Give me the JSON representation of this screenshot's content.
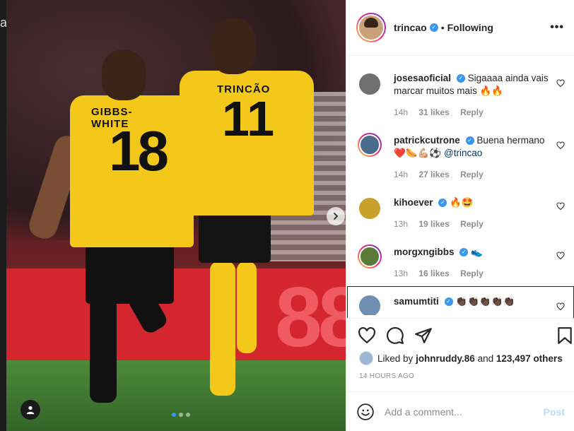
{
  "left_fragment": "a",
  "photo": {
    "player1_name": "GIBBS-WHITE",
    "player1_number": "18",
    "player2_name": "TRINCÃO",
    "player2_number": "11",
    "board_text": "88",
    "carousel_dots": 3,
    "carousel_active": 0
  },
  "header": {
    "username": "trincao",
    "separator": "•",
    "following": "Following",
    "more": "•••"
  },
  "comments": [
    {
      "username": "josesaoficial",
      "text": "Sigaaaa ainda vais marcar muitos mais 🔥🔥",
      "time": "14h",
      "likes": "31 likes",
      "reply": "Reply",
      "avatar_color": "#6f6f6f",
      "ring": false
    },
    {
      "username": "patrickcutrone",
      "text": "Buena hermano ❤️🌭💪🏼⚽",
      "mention": "@trincao",
      "time": "14h",
      "likes": "27 likes",
      "reply": "Reply",
      "avatar_color": "#4a6b8a",
      "ring": true
    },
    {
      "username": "kihoever",
      "text": "🔥🤩",
      "time": "13h",
      "likes": "19 likes",
      "reply": "Reply",
      "avatar_color": "#c7a12b",
      "ring": false
    },
    {
      "username": "morgxngibbs",
      "text": "👟",
      "time": "13h",
      "likes": "16 likes",
      "reply": "Reply",
      "avatar_color": "#5a7a3a",
      "ring": true
    },
    {
      "username": "samumtiti",
      "text": "👏🏿👏🏿👏🏿👏🏿👏🏿",
      "avatar_color": "#6f8fb0",
      "ring": false
    }
  ],
  "liked_by": {
    "prefix": "Liked by",
    "user": "johnruddy.86",
    "middle": "and",
    "others": "123,497 others"
  },
  "timestamp": "14 HOURS AGO",
  "add_comment": {
    "placeholder": "Add a comment...",
    "post": "Post"
  },
  "colors": {
    "accent": "#3897f0",
    "heart_outline": "#262626",
    "post_disabled": "#b2dffc",
    "muted": "#8e8e8e"
  }
}
